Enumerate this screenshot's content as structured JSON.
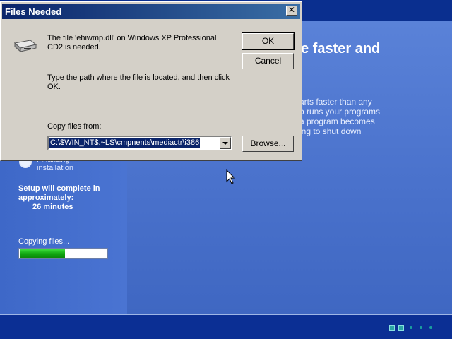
{
  "dialog": {
    "title": "Files Needed",
    "close_label": "✕",
    "message": "The file 'ehiwmp.dll' on Windows XP Professional CD2 is needed.",
    "instruction": "Type the path where the file is located, and then click OK.",
    "copy_from_label": "Copy files from:",
    "copy_from_value": "C:\\$WIN_NT$.~LS\\cmpnents\\mediactr\\i386",
    "ok_label": "OK",
    "cancel_label": "Cancel",
    "browse_label": "Browse..."
  },
  "setup": {
    "hero_title": "e faster and",
    "hero_desc": "arts faster than any\no runs your programs\na program becomes\ning to shut down",
    "step_label": "Finalizing\ninstallation",
    "complete_label": "Setup will complete in approximately:",
    "complete_time": "26 minutes",
    "copying_label": "Copying files...",
    "progress": 0.52
  },
  "colors": {
    "titlebar": "#0a246a",
    "dialog_face": "#d4d0c8",
    "setup_blue": "#4a72cc",
    "progress_green": "#12a812"
  },
  "icons": {
    "disk": "disk-drive-icon",
    "close": "close-icon",
    "cursor": "mouse-pointer-icon"
  }
}
